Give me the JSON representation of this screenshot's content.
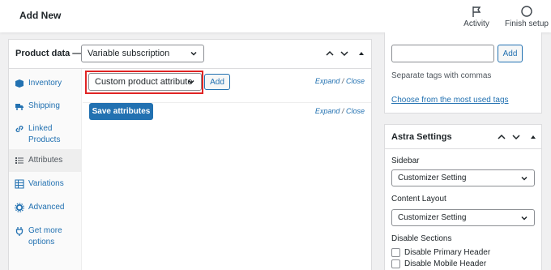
{
  "topbar": {
    "title": "Add New",
    "actions": [
      {
        "label": "Activity",
        "icon": "flag-icon"
      },
      {
        "label": "Finish setup",
        "icon": "circle-icon"
      }
    ]
  },
  "product_data": {
    "title": "Product data —",
    "type_value": "Variable subscription",
    "tabs": [
      {
        "label": "Inventory",
        "icon": "inventory-icon"
      },
      {
        "label": "Shipping",
        "icon": "truck-icon"
      },
      {
        "label": "Linked Products",
        "icon": "link-icon"
      },
      {
        "label": "Attributes",
        "icon": "list-icon",
        "active": true
      },
      {
        "label": "Variations",
        "icon": "grid-icon"
      },
      {
        "label": "Advanced",
        "icon": "gear-icon"
      },
      {
        "label": "Get more options",
        "icon": "plugin-icon"
      }
    ],
    "attribute_select_value": "Custom product attribute",
    "add_label": "Add",
    "expand_label": "Expand",
    "separator": "/",
    "close_label": "Close",
    "save_label": "Save attributes"
  },
  "tags": {
    "add_label": "Add",
    "hint": "Separate tags with commas",
    "most_used_link": "Choose from the most used tags"
  },
  "astra": {
    "title": "Astra Settings",
    "sidebar_label": "Sidebar",
    "sidebar_value": "Customizer Setting",
    "content_layout_label": "Content Layout",
    "content_layout_value": "Customizer Setting",
    "disable_sections_label": "Disable Sections",
    "checkboxes": [
      "Disable Primary Header",
      "Disable Mobile Header"
    ]
  },
  "colors": {
    "accent": "#2271b1",
    "highlight": "#e02424"
  }
}
